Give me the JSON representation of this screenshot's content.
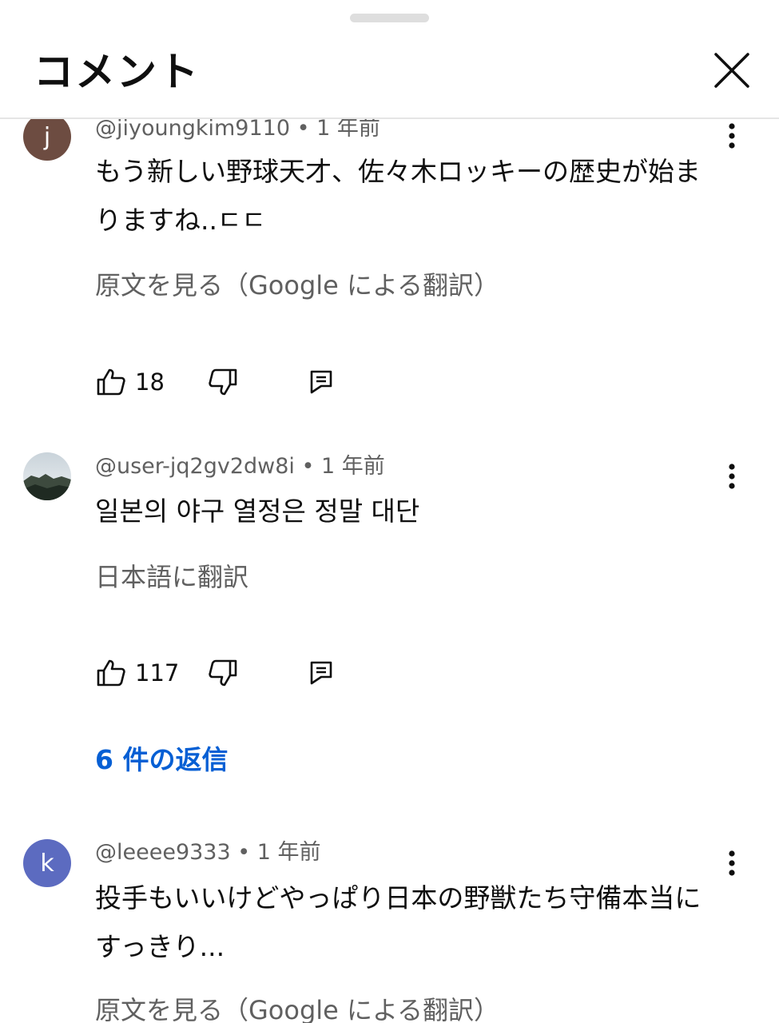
{
  "header": {
    "title": "コメント",
    "close_icon": "close-icon"
  },
  "comments": [
    {
      "avatar_letter": "j",
      "avatar_color": "#6d4c41",
      "meta": "@jiyoungkim9110 • 1 年前",
      "text": "もう新しい野球天才、佐々木ロッキーの歴史が始まりますね..ㄷㄷ",
      "translate": "原文を見る（Google による翻訳）",
      "likes": "18"
    },
    {
      "avatar_letter": "",
      "avatar_image": "mountain-landscape-avatar",
      "meta": "@user-jq2gv2dw8i • 1 年前",
      "text": "일본의 야구 열정은 정말 대단",
      "translate": "日本語に翻訳",
      "likes": "117",
      "replies": "6 件の返信"
    },
    {
      "avatar_letter": "k",
      "avatar_color": "#5c6bc0",
      "meta": "@leeee9333 • 1 年前",
      "text": "投手もいいけどやっぱり日本の野獣たち守備本当にすっきり...",
      "translate": "原文を見る（Google による翻訳）"
    }
  ],
  "colors": {
    "link": "#065fd4",
    "secondary_text": "#606060"
  }
}
